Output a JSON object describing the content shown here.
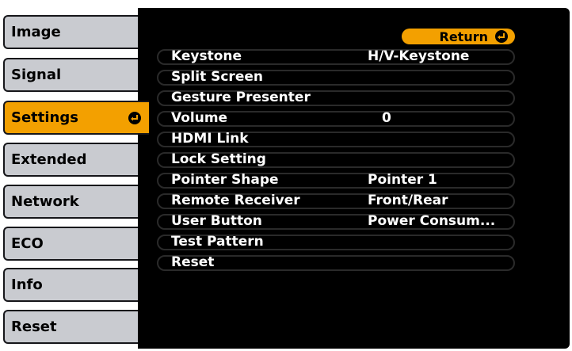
{
  "menu": {
    "items": [
      {
        "label": "Image"
      },
      {
        "label": "Signal"
      },
      {
        "label": "Settings"
      },
      {
        "label": "Extended"
      },
      {
        "label": "Network"
      },
      {
        "label": "ECO"
      },
      {
        "label": "Info"
      },
      {
        "label": "Reset"
      }
    ],
    "active_index": 2
  },
  "panel": {
    "return_label": "Return",
    "rows": [
      {
        "label": "Keystone",
        "value": "H/V-Keystone"
      },
      {
        "label": "Split Screen",
        "value": ""
      },
      {
        "label": "Gesture Presenter",
        "value": ""
      },
      {
        "label": "Volume",
        "value": "0"
      },
      {
        "label": "HDMI Link",
        "value": ""
      },
      {
        "label": "Lock Setting",
        "value": ""
      },
      {
        "label": "Pointer Shape",
        "value": "Pointer 1"
      },
      {
        "label": "Remote Receiver",
        "value": "Front/Rear"
      },
      {
        "label": "User Button",
        "value": "Power Consum..."
      },
      {
        "label": "Test Pattern",
        "value": ""
      },
      {
        "label": "Reset",
        "value": ""
      }
    ]
  },
  "colors": {
    "accent": "#f3a000",
    "tab_background": "#c9cbd0",
    "panel_background": "#000000"
  },
  "icons": {
    "enter": "enter-icon"
  }
}
